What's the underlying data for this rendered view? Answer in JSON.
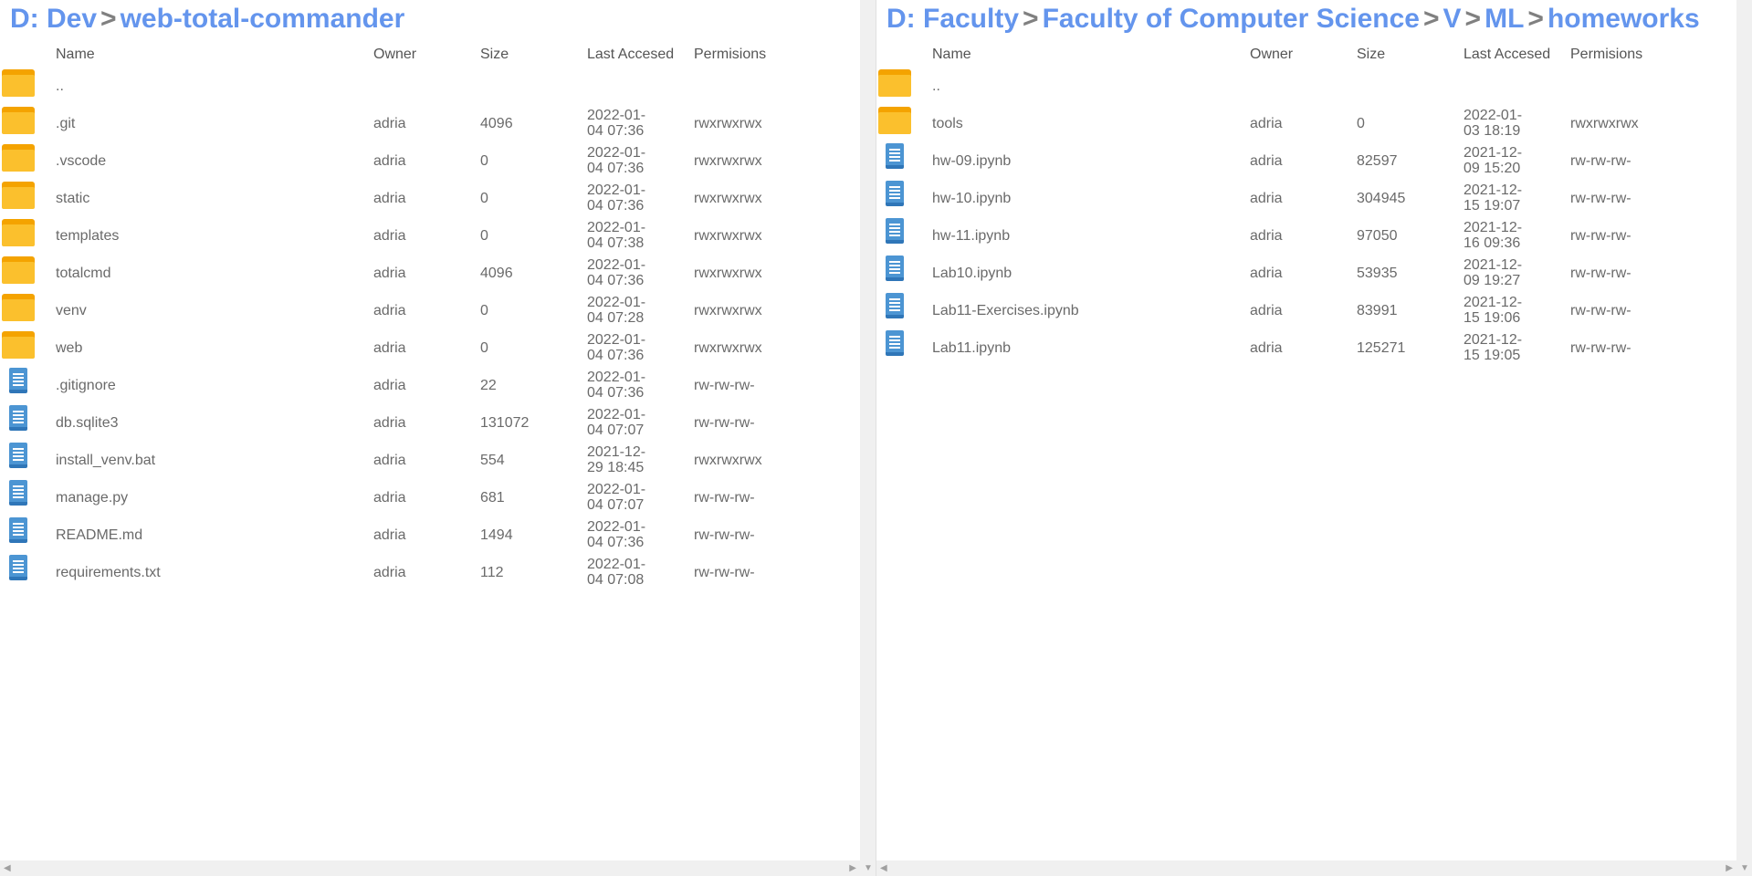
{
  "columns": {
    "name": "Name",
    "owner": "Owner",
    "size": "Size",
    "date": "Last Accesed",
    "perm": "Permisions"
  },
  "separator": ">",
  "left": {
    "path": [
      "D: Dev",
      "web-total-commander"
    ],
    "files": [
      {
        "type": "folder",
        "name": "..",
        "owner": "",
        "size": "",
        "date": "",
        "perm": ""
      },
      {
        "type": "folder",
        "name": ".git",
        "owner": "adria",
        "size": "4096",
        "date": "2022-01-04 07:36",
        "perm": "rwxrwxrwx"
      },
      {
        "type": "folder",
        "name": ".vscode",
        "owner": "adria",
        "size": "0",
        "date": "2022-01-04 07:36",
        "perm": "rwxrwxrwx"
      },
      {
        "type": "folder",
        "name": "static",
        "owner": "adria",
        "size": "0",
        "date": "2022-01-04 07:36",
        "perm": "rwxrwxrwx"
      },
      {
        "type": "folder",
        "name": "templates",
        "owner": "adria",
        "size": "0",
        "date": "2022-01-04 07:38",
        "perm": "rwxrwxrwx"
      },
      {
        "type": "folder",
        "name": "totalcmd",
        "owner": "adria",
        "size": "4096",
        "date": "2022-01-04 07:36",
        "perm": "rwxrwxrwx"
      },
      {
        "type": "folder",
        "name": "venv",
        "owner": "adria",
        "size": "0",
        "date": "2022-01-04 07:28",
        "perm": "rwxrwxrwx"
      },
      {
        "type": "folder",
        "name": "web",
        "owner": "adria",
        "size": "0",
        "date": "2022-01-04 07:36",
        "perm": "rwxrwxrwx"
      },
      {
        "type": "file",
        "name": ".gitignore",
        "owner": "adria",
        "size": "22",
        "date": "2022-01-04 07:36",
        "perm": "rw-rw-rw-"
      },
      {
        "type": "file",
        "name": "db.sqlite3",
        "owner": "adria",
        "size": "131072",
        "date": "2022-01-04 07:07",
        "perm": "rw-rw-rw-"
      },
      {
        "type": "file",
        "name": "install_venv.bat",
        "owner": "adria",
        "size": "554",
        "date": "2021-12-29 18:45",
        "perm": "rwxrwxrwx"
      },
      {
        "type": "file",
        "name": "manage.py",
        "owner": "adria",
        "size": "681",
        "date": "2022-01-04 07:07",
        "perm": "rw-rw-rw-"
      },
      {
        "type": "file",
        "name": "README.md",
        "owner": "adria",
        "size": "1494",
        "date": "2022-01-04 07:36",
        "perm": "rw-rw-rw-"
      },
      {
        "type": "file",
        "name": "requirements.txt",
        "owner": "adria",
        "size": "112",
        "date": "2022-01-04 07:08",
        "perm": "rw-rw-rw-"
      }
    ]
  },
  "right": {
    "path": [
      "D: Faculty",
      "Faculty of Computer Science",
      "V",
      "ML",
      "homeworks"
    ],
    "files": [
      {
        "type": "folder",
        "name": "..",
        "owner": "",
        "size": "",
        "date": "",
        "perm": ""
      },
      {
        "type": "folder",
        "name": "tools",
        "owner": "adria",
        "size": "0",
        "date": "2022-01-03 18:19",
        "perm": "rwxrwxrwx"
      },
      {
        "type": "file",
        "name": "hw-09.ipynb",
        "owner": "adria",
        "size": "82597",
        "date": "2021-12-09 15:20",
        "perm": "rw-rw-rw-"
      },
      {
        "type": "file",
        "name": "hw-10.ipynb",
        "owner": "adria",
        "size": "304945",
        "date": "2021-12-15 19:07",
        "perm": "rw-rw-rw-"
      },
      {
        "type": "file",
        "name": "hw-11.ipynb",
        "owner": "adria",
        "size": "97050",
        "date": "2021-12-16 09:36",
        "perm": "rw-rw-rw-"
      },
      {
        "type": "file",
        "name": "Lab10.ipynb",
        "owner": "adria",
        "size": "53935",
        "date": "2021-12-09 19:27",
        "perm": "rw-rw-rw-"
      },
      {
        "type": "file",
        "name": "Lab11-Exercises.ipynb",
        "owner": "adria",
        "size": "83991",
        "date": "2021-12-15 19:06",
        "perm": "rw-rw-rw-"
      },
      {
        "type": "file",
        "name": "Lab11.ipynb",
        "owner": "adria",
        "size": "125271",
        "date": "2021-12-15 19:05",
        "perm": "rw-rw-rw-"
      }
    ]
  }
}
